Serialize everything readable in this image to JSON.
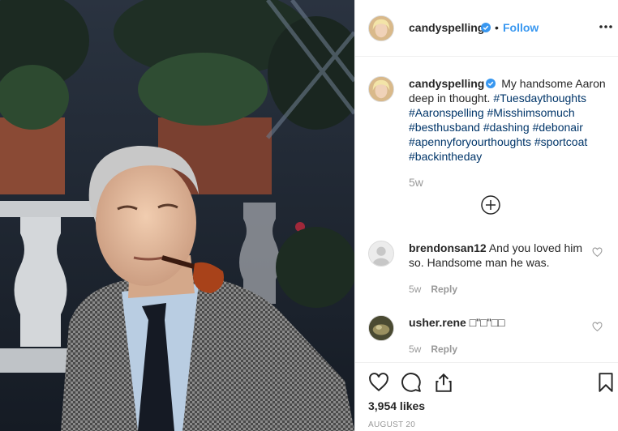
{
  "header": {
    "username": "candyspelling",
    "separator": "•",
    "follow_label": "Follow",
    "verified_icon": "verified-badge-icon",
    "more_icon": "more-options-icon"
  },
  "caption": {
    "username": "candyspelling",
    "text": "My handsome Aaron deep in thought.",
    "hashtags": [
      "#Tuesdaythoughts",
      "#Aaronspelling",
      "#Misshimsomuch",
      "#besthusband",
      "#dashing",
      "#debonair",
      "#apennyforyourthoughts",
      "#sportcoat",
      "#backintheday"
    ],
    "time": "5w"
  },
  "comments": [
    {
      "username": "brendonsan12",
      "text": "And you loved him so. Handsome man he was.",
      "time": "5w",
      "reply_label": "Reply"
    },
    {
      "username": "usher.rene",
      "text": "□\"□\"□□",
      "time": "5w",
      "reply_label": "Reply"
    }
  ],
  "actions": {
    "icons": [
      "heart-icon",
      "comment-icon",
      "share-icon",
      "bookmark-icon"
    ],
    "likes": "3,954 likes",
    "date": "AUGUST 20"
  },
  "colors": {
    "accent": "#3897f0",
    "hashtag": "#003569",
    "muted": "#999999",
    "verified": "#3897f0"
  }
}
